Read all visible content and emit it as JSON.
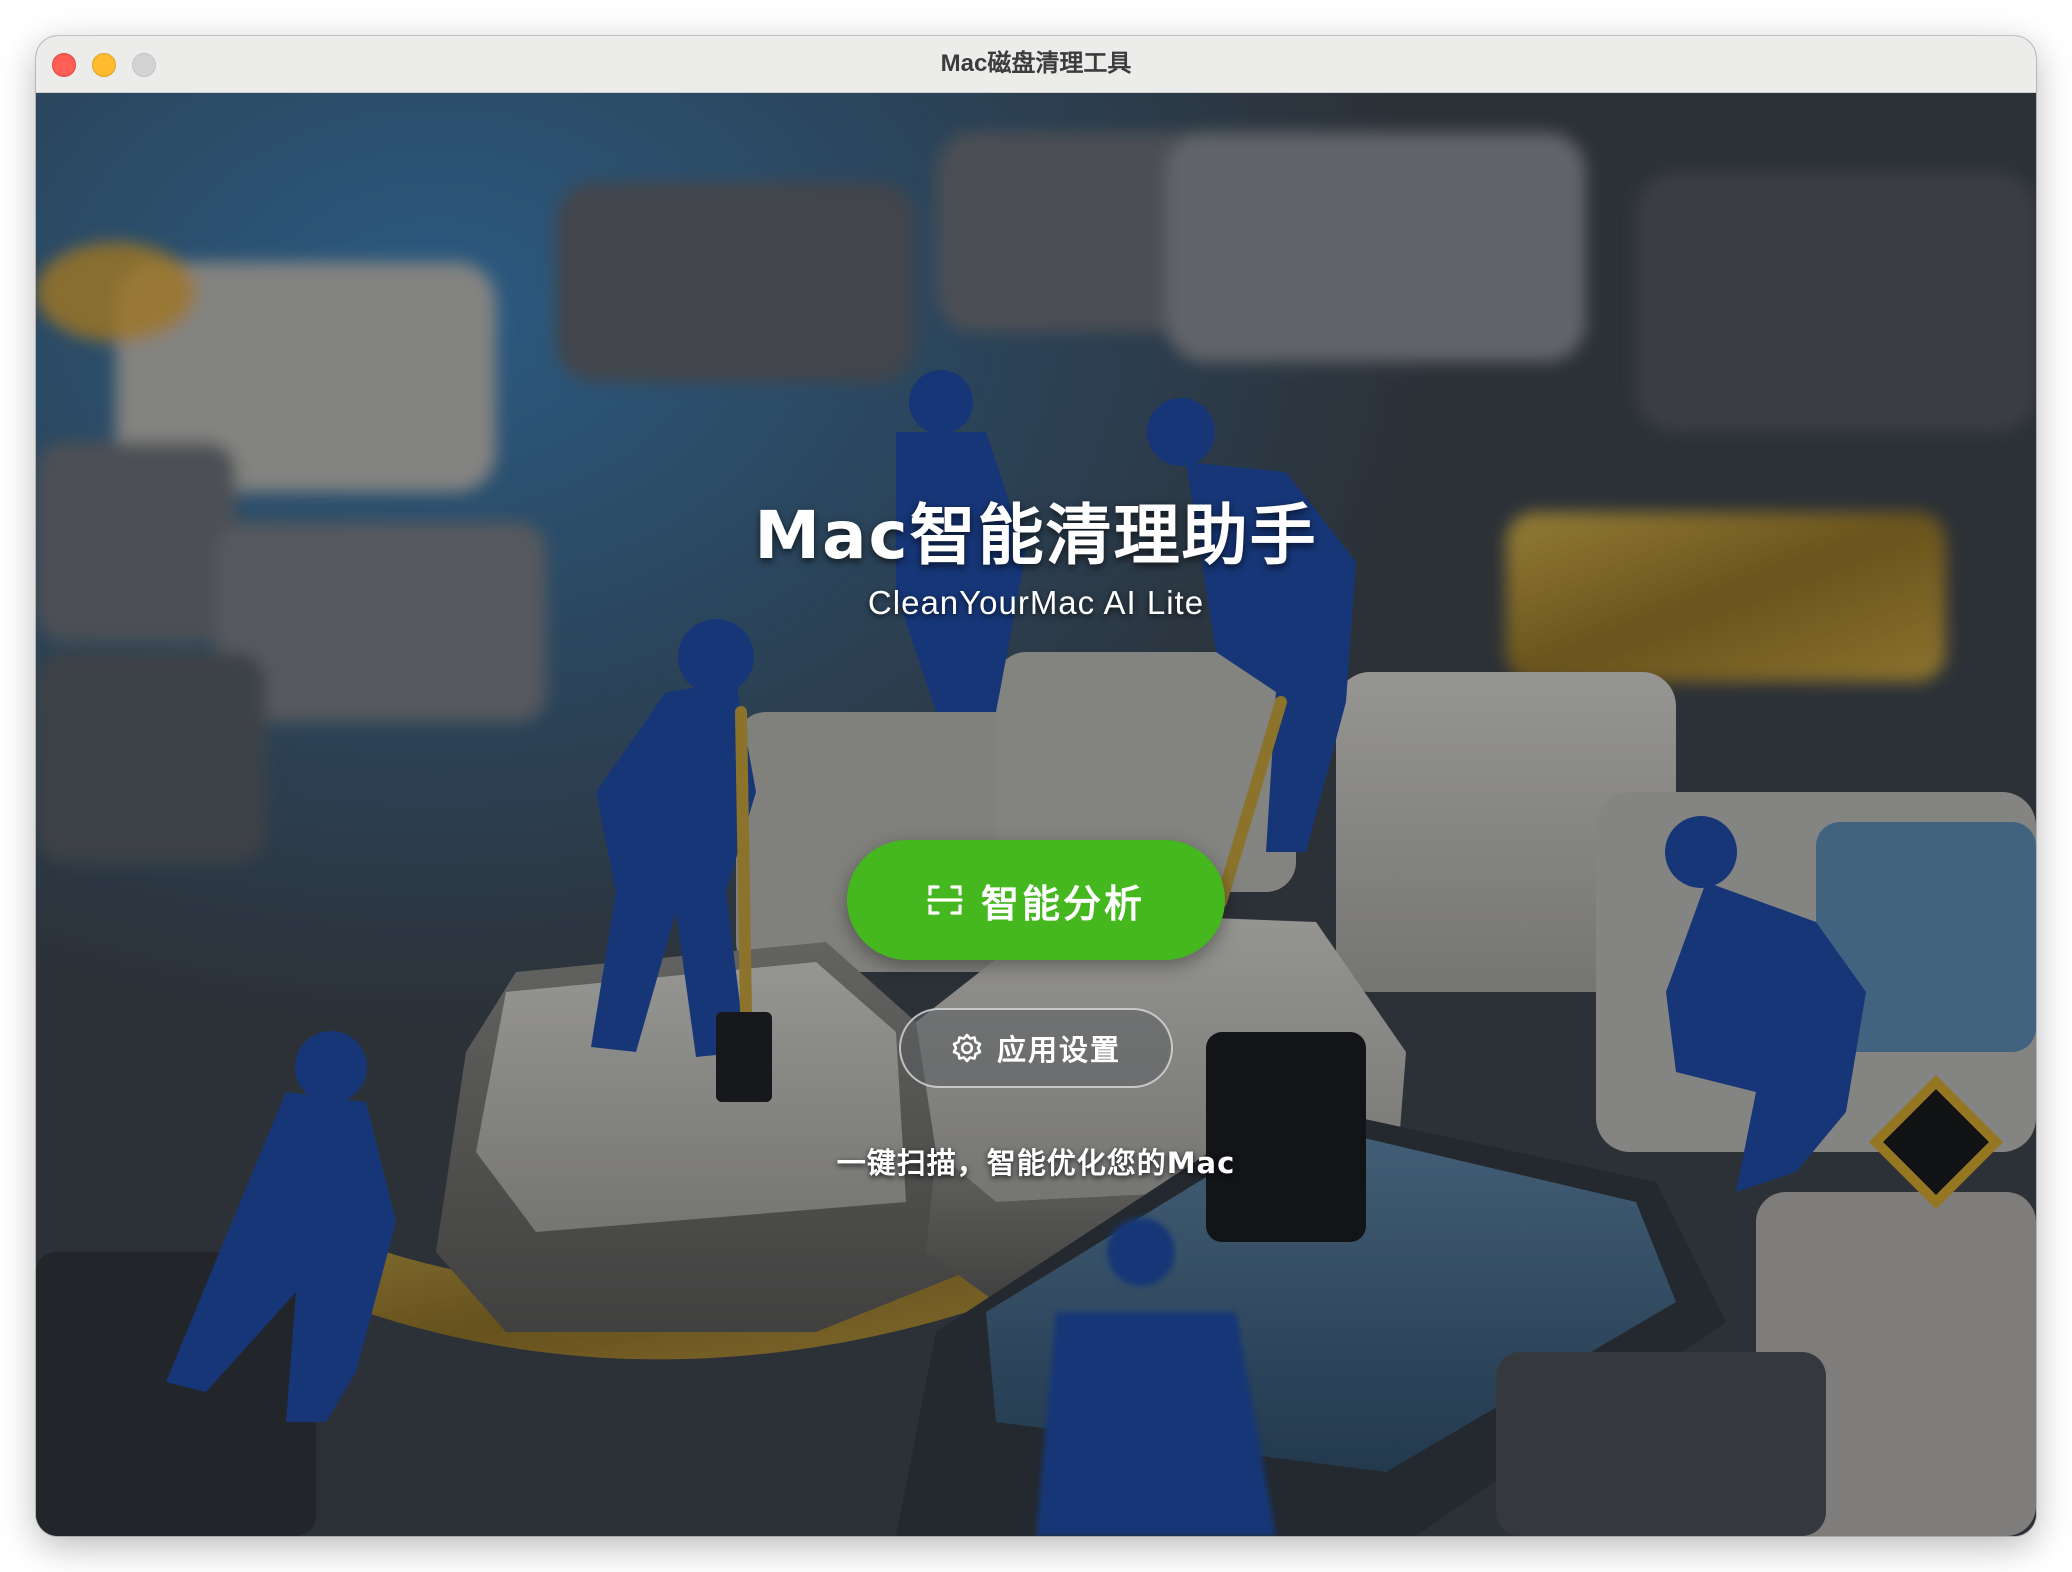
{
  "window": {
    "title": "Mac磁盘清理工具"
  },
  "main": {
    "app_title": "Mac智能清理助手",
    "app_subtitle": "CleanYourMac AI Lite",
    "analyze_button": {
      "label": "智能分析",
      "icon": "scan-icon",
      "color": "#45b81f"
    },
    "settings_button": {
      "label": "应用设置",
      "icon": "gear-icon"
    },
    "tagline": "一键扫描，智能优化您的Mac"
  },
  "background": {
    "description_icon": "keyboard-cleaning-workers-image"
  }
}
